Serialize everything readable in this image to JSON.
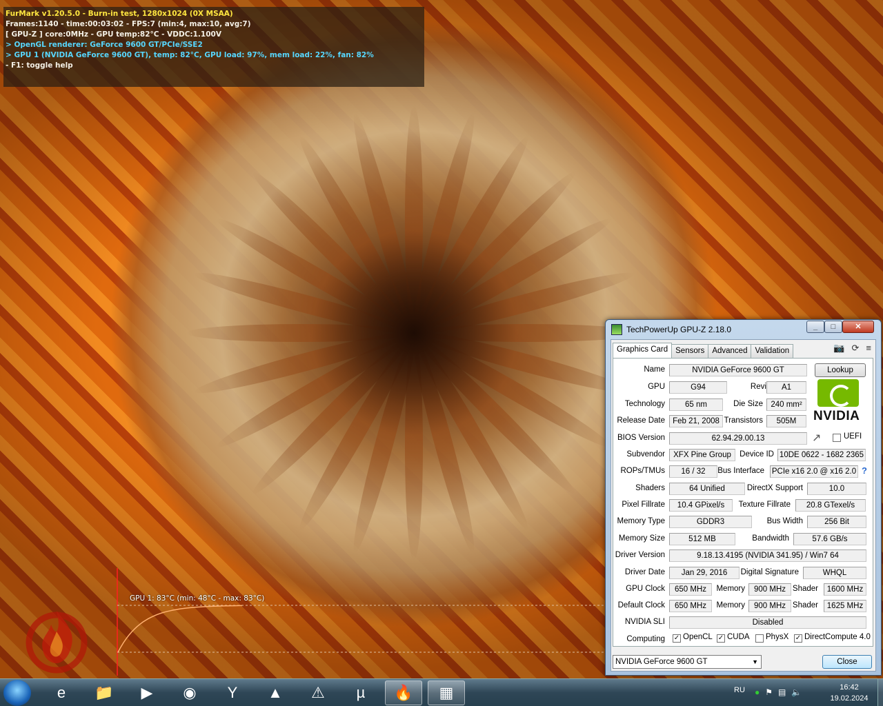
{
  "osd": {
    "line1": "FurMark v1.20.5.0 - Burn-in test, 1280x1024 (0X MSAA)",
    "line2": "Frames:1140 - time:00:03:02 - FPS:7 (min:4, max:10, avg:7)",
    "line3": "[ GPU-Z ] core:0MHz - GPU temp:82°C - VDDC:1.100V",
    "line4": "> OpenGL renderer: GeForce 9600 GT/PCIe/SSE2",
    "line5": "> GPU 1 (NVIDIA GeForce 9600 GT), temp: 82°C, GPU load: 97%, mem load: 22%, fan: 82%",
    "line6": "- F1: toggle help"
  },
  "temp_graph": {
    "label": "GPU 1: 83°C (min: 48°C - max: 83°C)",
    "min_c": 48,
    "max_c": 83,
    "current_c": 83
  },
  "gpuz": {
    "title": "TechPowerUp GPU-Z 2.18.0",
    "win_min": "_",
    "win_max": "□",
    "win_close": "✕",
    "tabs": [
      "Graphics Card",
      "Sensors",
      "Advanced",
      "Validation"
    ],
    "tool_icons": [
      "📷",
      "⟳",
      "≡"
    ],
    "lookup_label": "Lookup",
    "nvidia_word": "NVIDIA",
    "uefi_label": "UEFI",
    "help_glyph": "?",
    "share_glyph": "↗",
    "labels": {
      "name": "Name",
      "gpu": "GPU",
      "revision": "Revision",
      "technology": "Technology",
      "die_size": "Die Size",
      "release_date": "Release Date",
      "transistors": "Transistors",
      "bios_version": "BIOS Version",
      "subvendor": "Subvendor",
      "device_id": "Device ID",
      "rops_tmus": "ROPs/TMUs",
      "bus_interface": "Bus Interface",
      "shaders": "Shaders",
      "directx": "DirectX Support",
      "pixel_fillrate": "Pixel Fillrate",
      "texture_fillrate": "Texture Fillrate",
      "memory_type": "Memory Type",
      "bus_width": "Bus Width",
      "memory_size": "Memory Size",
      "bandwidth": "Bandwidth",
      "driver_version": "Driver Version",
      "driver_date": "Driver Date",
      "digital_signature": "Digital Signature",
      "gpu_clock": "GPU Clock",
      "memory": "Memory",
      "shader": "Shader",
      "default_clock": "Default Clock",
      "nvidia_sli": "NVIDIA SLI",
      "computing": "Computing"
    },
    "values": {
      "name": "NVIDIA GeForce 9600 GT",
      "gpu": "G94",
      "revision": "A1",
      "technology": "65 nm",
      "die_size": "240 mm²",
      "release_date": "Feb 21, 2008",
      "transistors": "505M",
      "bios_version": "62.94.29.00.13",
      "subvendor": "XFX Pine Group",
      "device_id": "10DE 0622 - 1682 2365",
      "rops_tmus": "16 / 32",
      "bus_interface": "PCIe x16 2.0 @ x16 2.0",
      "shaders": "64 Unified",
      "directx": "10.0",
      "pixel_fillrate": "10.4 GPixel/s",
      "texture_fillrate": "20.8 GTexel/s",
      "memory_type": "GDDR3",
      "bus_width": "256 Bit",
      "memory_size": "512 MB",
      "bandwidth": "57.6 GB/s",
      "driver_version": "9.18.13.4195 (NVIDIA 341.95) / Win7 64",
      "driver_date": "Jan 29, 2016",
      "digital_signature": "WHQL",
      "gpu_clock": "650 MHz",
      "memory_clock": "900 MHz",
      "shader_clock": "1600 MHz",
      "default_clock": "650 MHz",
      "default_memory": "900 MHz",
      "default_shader": "1625 MHz",
      "nvidia_sli": "Disabled"
    },
    "computing": [
      {
        "label": "OpenCL",
        "checked": true
      },
      {
        "label": "CUDA",
        "checked": true
      },
      {
        "label": "PhysX",
        "checked": false
      },
      {
        "label": "DirectCompute 4.0",
        "checked": true
      }
    ],
    "uefi_checked": false,
    "card_select": "NVIDIA GeForce 9600 GT",
    "close_label": "Close"
  },
  "taskbar": {
    "apps": [
      {
        "name": "internet-explorer",
        "glyph": "e",
        "active": false
      },
      {
        "name": "explorer",
        "glyph": "📁",
        "active": false
      },
      {
        "name": "media-player",
        "glyph": "▶",
        "active": false
      },
      {
        "name": "paint",
        "glyph": "◉",
        "active": false
      },
      {
        "name": "yandex-browser",
        "glyph": "Y",
        "active": false
      },
      {
        "name": "aimp",
        "glyph": "▲",
        "active": false
      },
      {
        "name": "avast",
        "glyph": "⚠",
        "active": false
      },
      {
        "name": "utorrent",
        "glyph": "µ",
        "active": false
      },
      {
        "name": "furmark",
        "glyph": "🔥",
        "active": true
      },
      {
        "name": "gpu-z",
        "glyph": "▦",
        "active": true
      }
    ],
    "lang": "RU",
    "time": "16:42",
    "date": "19.02.2024"
  }
}
